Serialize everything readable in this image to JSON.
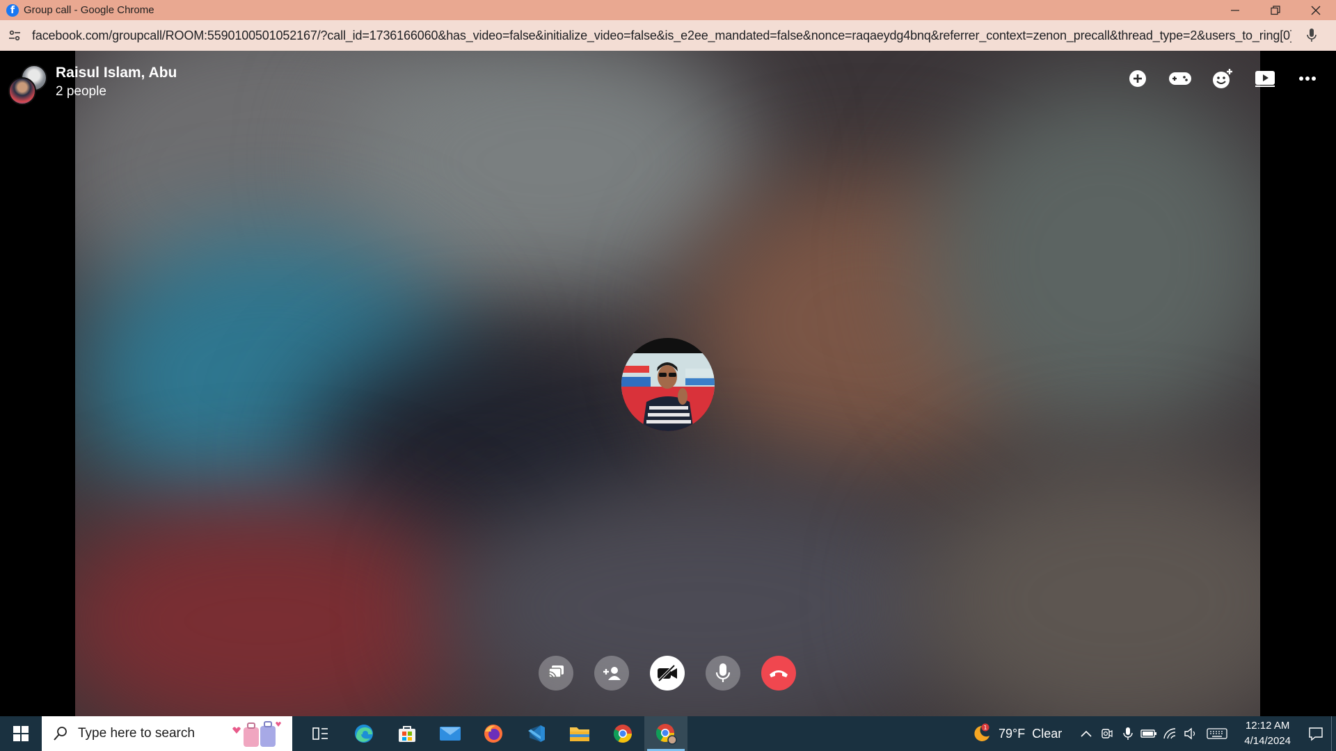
{
  "window": {
    "title": "Group call - Google Chrome",
    "favicon_letter": "f"
  },
  "address_bar": {
    "url": "facebook.com/groupcall/ROOM:5590100501052167/?call_id=1736166060&has_video=false&initialize_video=false&is_e2ee_mandated=false&nonce=raqaeydg4bnq&referrer_context=zenon_precall&thread_type=2&users_to_ring[0]=..."
  },
  "call": {
    "title": "Raisul Islam, Abu",
    "subtitle": "2 people",
    "top_actions": [
      "add-icon",
      "games-icon",
      "effects-icon",
      "watch-together-icon",
      "more-icon"
    ],
    "controls": [
      "share-screen-icon",
      "add-person-icon",
      "video-off-icon",
      "microphone-icon",
      "end-call-icon"
    ],
    "end_call_color": "#f0474f"
  },
  "taskbar": {
    "search_placeholder": "Type here to search",
    "apps": [
      "task-view-icon",
      "edge-icon",
      "store-icon",
      "mail-icon",
      "firefox-icon",
      "vscode-icon",
      "file-explorer-icon",
      "chrome-icon",
      "chrome-profile-icon"
    ],
    "weather": {
      "badge": "1",
      "temp": "79°F",
      "condition": "Clear"
    },
    "time": "12:12 AM",
    "date": "4/14/2024"
  },
  "colors": {
    "titlebar": "#e9a891",
    "addressbar": "#f3ddd4",
    "taskbar": "#1a3140"
  }
}
